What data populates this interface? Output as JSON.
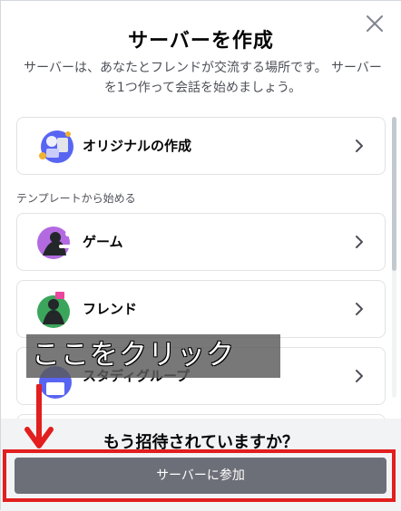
{
  "dialog": {
    "title": "サーバーを作成",
    "subtitle": "サーバーは、あなたとフレンドが交流する場所です。 サーバーを1つ作って会話を始めましょう。",
    "close_icon": "close-icon"
  },
  "create_own": {
    "label": "オリジナルの作成",
    "icon": "create-server-icon"
  },
  "templates": {
    "header": "テンプレートから始める",
    "items": [
      {
        "label": "ゲーム",
        "icon": "gaming-icon"
      },
      {
        "label": "フレンド",
        "icon": "friends-icon"
      },
      {
        "label": "スタディグループ",
        "icon": "study-group-icon"
      }
    ]
  },
  "footer": {
    "title": "もう招待されていますか？",
    "join_button": "サーバーに参加"
  },
  "annotation": {
    "text": "ここをクリック",
    "color": "#e21e1e"
  },
  "colors": {
    "button": "#6d6f78",
    "footer_bg": "#f2f3f5",
    "highlight": "#e21e1e"
  }
}
